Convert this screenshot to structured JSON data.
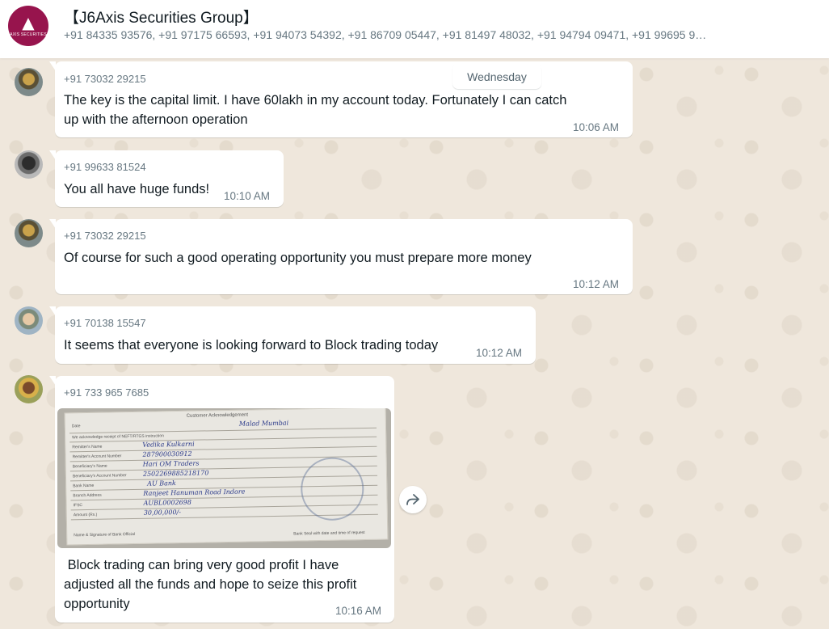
{
  "header": {
    "avatar_logo_text": "AXIS SECURITIES",
    "title": "【J6Axis Securities Group】",
    "members": "+91 84335 93576, +91 97175 66593, +91 94073 54392, +91 86709 05447, +91 81497 48032, +91 94794 09471, +91 99695 9…"
  },
  "day_chip": "Wednesday",
  "messages": [
    {
      "sender": "+91 73032 29215",
      "lines": [
        "The key is the capital limit. I have 60lakh in my account today. Fortunately I can catch",
        "up with the afternoon operation"
      ],
      "time": "10:06 AM"
    },
    {
      "sender": "+91 99633 81524",
      "lines": [
        "You all have huge funds!"
      ],
      "time": "10:10 AM"
    },
    {
      "sender": "+91 73032 29215",
      "lines": [
        "Of course for such a good operating opportunity you must prepare more money"
      ],
      "time": "10:12 AM"
    },
    {
      "sender": "+91 70138 15547",
      "lines": [
        "It seems that everyone is looking forward to Block trading today"
      ],
      "time": "10:12 AM"
    },
    {
      "sender": "+91 733 965 7685",
      "lines": [
        " Block trading can bring very good profit I have",
        "adjusted all the funds and hope to seize this profit",
        "opportunity"
      ],
      "time": "10:16 AM",
      "image": {
        "title": "Customer Acknowledgement",
        "labels": [
          "Date",
          "We acknowledge receipt of NEFT/RTGS instruction",
          "Remitter's Name",
          "Remitter's Account Number",
          "Beneficiary's Name",
          "Beneficiary's Account Number",
          "Bank Name",
          "Branch Address",
          "IFSC",
          "Amount (Rs.)"
        ],
        "handwritten": {
          "branch": "Malad Mumbai",
          "remitter_name": "Vedika Kulkarni",
          "remitter_account": "287900030912",
          "beneficiary_name": "Hari OM Traders",
          "beneficiary_account": "2502269885218170",
          "bank_name": "AU Bank",
          "branch_address": "Ranjeet Hanuman Road Indore",
          "ifsc": "AUBL0002698",
          "amount": "30,00,000/-"
        },
        "footer_left": "Name & Signature of Bank Official",
        "footer_right": "Bank Seal with date and time of request"
      }
    }
  ],
  "icons": {
    "forward": "forward-icon"
  }
}
